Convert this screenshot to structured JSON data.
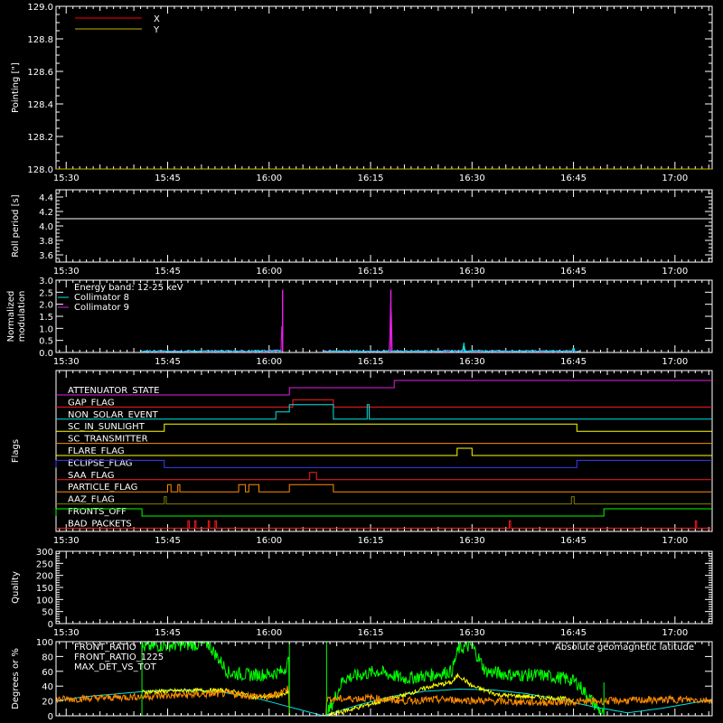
{
  "x_axis": {
    "tick_labels": [
      "15:30",
      "15:45",
      "16:00",
      "16:15",
      "16:30",
      "16:45",
      "17:00"
    ],
    "tick_minutes": [
      930,
      945,
      960,
      975,
      990,
      1005,
      1020
    ],
    "range_minutes": [
      928.5,
      1025.5
    ]
  },
  "colors": {
    "background": "#000000",
    "axis": "#ffffff",
    "x": "#ff0000",
    "y": "#c8b400",
    "collimator8": "#00e5e5",
    "collimator9": "#e61ee6",
    "front_ratio": "#ffff00",
    "front_ratio_1225": "#00ff00",
    "max_det_vs_tot": "#ff8c00",
    "geomag": "#00e5e5"
  },
  "chart_data": [
    {
      "type": "line",
      "panel": "pointing",
      "ylabel": "Pointing [\"]",
      "ylim": [
        128.0,
        129.0
      ],
      "ytick_labels": [
        "128.0",
        "128.2",
        "128.4",
        "128.6",
        "128.8",
        "129.0"
      ],
      "legend": [
        {
          "name": "X",
          "color": "#ff0000"
        },
        {
          "name": "Y",
          "color": "#c8b400"
        }
      ],
      "series": [
        {
          "name": "X",
          "x": [
            928.5,
            1025.5
          ],
          "values": [
            128.0,
            128.0
          ]
        },
        {
          "name": "Y",
          "x": [
            928.5,
            1025.5
          ],
          "values": [
            128.0,
            128.0
          ]
        }
      ]
    },
    {
      "type": "line",
      "panel": "roll_period",
      "ylabel": "Roll period [s]",
      "ylim": [
        3.5,
        4.5
      ],
      "ytick_labels": [
        "3.6",
        "3.8",
        "4.0",
        "4.2",
        "4.4"
      ],
      "series": [
        {
          "name": "Roll period",
          "x": [
            928.5,
            1025.5
          ],
          "values": [
            4.1,
            4.1
          ]
        }
      ]
    },
    {
      "type": "line",
      "panel": "modulation",
      "ylabel": "Normalized modulation",
      "ylim": [
        0.0,
        3.0
      ],
      "ytick_labels": [
        "0.0",
        "0.5",
        "1.0",
        "1.5",
        "2.0",
        "2.5",
        "3.0"
      ],
      "legend_title": "Energy band: 12-25 keV",
      "legend": [
        {
          "name": "Collimator 8",
          "color": "#00e5e5"
        },
        {
          "name": "Collimator 9",
          "color": "#e61ee6"
        }
      ],
      "series": [
        {
          "name": "Collimator 8",
          "x": [
            941,
            956,
            961.8,
            962,
            962,
            971,
            988.6,
            988.8,
            989,
            1000,
            1004.7,
            1005,
            1005.2,
            1006
          ],
          "values": [
            0.05,
            0.06,
            0.08,
            0.08,
            0.05,
            0.05,
            0.06,
            0.4,
            0.06,
            0.06,
            0.06,
            0.2,
            0.06,
            0.06
          ]
        },
        {
          "name": "Collimator 9",
          "x": [
            941,
            961.8,
            962,
            962.2,
            968,
            968,
            977.8,
            978,
            978.2,
            989,
            1006
          ],
          "values": [
            0.05,
            0.05,
            2.6,
            0.05,
            0.05,
            0.05,
            0.05,
            2.6,
            0.05,
            0.05,
            0.05
          ]
        }
      ]
    },
    {
      "type": "line",
      "panel": "flags",
      "ylabel": "Flags",
      "flags": [
        {
          "name": "ATTENUATOR_STATE",
          "color": "#e61ee6",
          "on": [
            [
              963,
              978.5
            ],
            [
              978.5,
              1025.5
            ]
          ],
          "level": [
            1,
            2
          ]
        },
        {
          "name": "GAP_FLAG",
          "color": "#ff1a1a",
          "on": [
            [
              963.5,
              969.5
            ]
          ]
        },
        {
          "name": "NON_SOLAR_EVENT",
          "color": "#00e5e5",
          "on": [
            [
              961,
              963
            ],
            [
              963,
              969.5
            ],
            [
              974.5,
              974.8
            ]
          ],
          "level": [
            1,
            2,
            2
          ]
        },
        {
          "name": "SC_IN_SUNLIGHT",
          "color": "#ffff00",
          "on": [
            [
              944.5,
              1005.5
            ]
          ]
        },
        {
          "name": "SC_TRANSMITTER",
          "color": "#ff8c00",
          "on": []
        },
        {
          "name": "FLARE_FLAG",
          "color": "#ffff00",
          "on": [
            [
              987.8,
              990
            ]
          ]
        },
        {
          "name": "ECLIPSE_FLAG",
          "color": "#3a3aff",
          "on": [
            [
              928.5,
              944.5
            ],
            [
              1005.5,
              1025.5
            ]
          ]
        },
        {
          "name": "SAA_FLAG",
          "color": "#ff1a1a",
          "on": [
            [
              966,
              967
            ]
          ]
        },
        {
          "name": "PARTICLE_FLAG",
          "color": "#ff8c00",
          "on": [
            [
              945,
              945.5
            ],
            [
              946.5,
              946.8
            ],
            [
              955.5,
              956.5
            ],
            [
              957,
              958.5
            ],
            [
              963,
              969.5
            ]
          ]
        },
        {
          "name": "AAZ_FLAG",
          "color": "#808000",
          "on": [
            [
              944.5,
              944.8
            ],
            [
              1004.7,
              1005.1
            ]
          ]
        },
        {
          "name": "FRONTS_OFF",
          "color": "#00ff00",
          "on": [
            [
              928.5,
              941.2
            ],
            [
              1009.5,
              1025.5
            ]
          ]
        },
        {
          "name": "BAD_PACKETS",
          "color": "#ff1a1a",
          "on": [
            [
              948,
              948.2
            ],
            [
              949,
              949.2
            ],
            [
              951,
              951.2
            ],
            [
              952,
              952.2
            ],
            [
              995.5,
              995.7
            ],
            [
              1023,
              1023.2
            ]
          ]
        }
      ]
    },
    {
      "type": "line",
      "panel": "quality",
      "ylabel": "Quality",
      "ylim": [
        0,
        300
      ],
      "ytick_labels": [
        "0",
        "50",
        "100",
        "150",
        "200",
        "250",
        "300"
      ],
      "series": []
    },
    {
      "type": "line",
      "panel": "ratios",
      "ylabel": "Degrees or %",
      "ylim": [
        0,
        100
      ],
      "ytick_labels": [
        "0",
        "20",
        "40",
        "60",
        "80",
        "100"
      ],
      "legend": [
        {
          "name": "FRONT_RATIO",
          "color": "#ffff00"
        },
        {
          "name": "FRONT_RATIO_1225",
          "color": "#00ff00"
        },
        {
          "name": "MAX_DET_VS_TOT",
          "color": "#ff8c00"
        }
      ],
      "annotation": "Absolute geomagnetic latitude",
      "series": [
        {
          "name": "FRONT_RATIO_1225",
          "x": [
            941.2,
            944,
            948,
            951,
            954,
            957,
            960,
            962,
            963,
            963,
            968.5,
            971,
            976,
            980,
            984,
            987,
            988,
            990,
            992,
            996,
            1000,
            1004,
            1005.5,
            1009.5
          ],
          "values": [
            92,
            95,
            96,
            97,
            58,
            55,
            56,
            60,
            75,
            0,
            0,
            50,
            60,
            50,
            55,
            60,
            90,
            95,
            60,
            55,
            55,
            50,
            45,
            0
          ],
          "baseline": 100
        },
        {
          "name": "FRONT_RATIO",
          "x": [
            941.2,
            948,
            954,
            958,
            962,
            963,
            963,
            968.5,
            980,
            984,
            987,
            988,
            990,
            994,
            1000,
            1005
          ],
          "values": [
            32,
            34,
            34,
            25,
            28,
            32,
            0,
            0,
            28,
            40,
            45,
            55,
            40,
            28,
            25,
            22
          ]
        },
        {
          "name": "MAX_DET_VS_TOT",
          "x": [
            928.5,
            935,
            941,
            948,
            954,
            960,
            963,
            963,
            968.5,
            968.5,
            975,
            980,
            986,
            992,
            1000,
            1010,
            1020,
            1025.5
          ],
          "values": [
            22,
            24,
            26,
            28,
            30,
            25,
            38,
            0,
            0,
            22,
            24,
            20,
            22,
            20,
            18,
            20,
            22,
            21
          ]
        },
        {
          "name": "Absolute geomagnetic latitude",
          "x": [
            928.5,
            933,
            938,
            943,
            948,
            953,
            958,
            963,
            968,
            973,
            978,
            983,
            988,
            993,
            998,
            1003,
            1008,
            1013,
            1018,
            1025.5
          ],
          "values": [
            20,
            26,
            30,
            34,
            35,
            32,
            24,
            12,
            0,
            14,
            26,
            33,
            36,
            35,
            30,
            22,
            12,
            4,
            10,
            22
          ]
        }
      ]
    }
  ]
}
